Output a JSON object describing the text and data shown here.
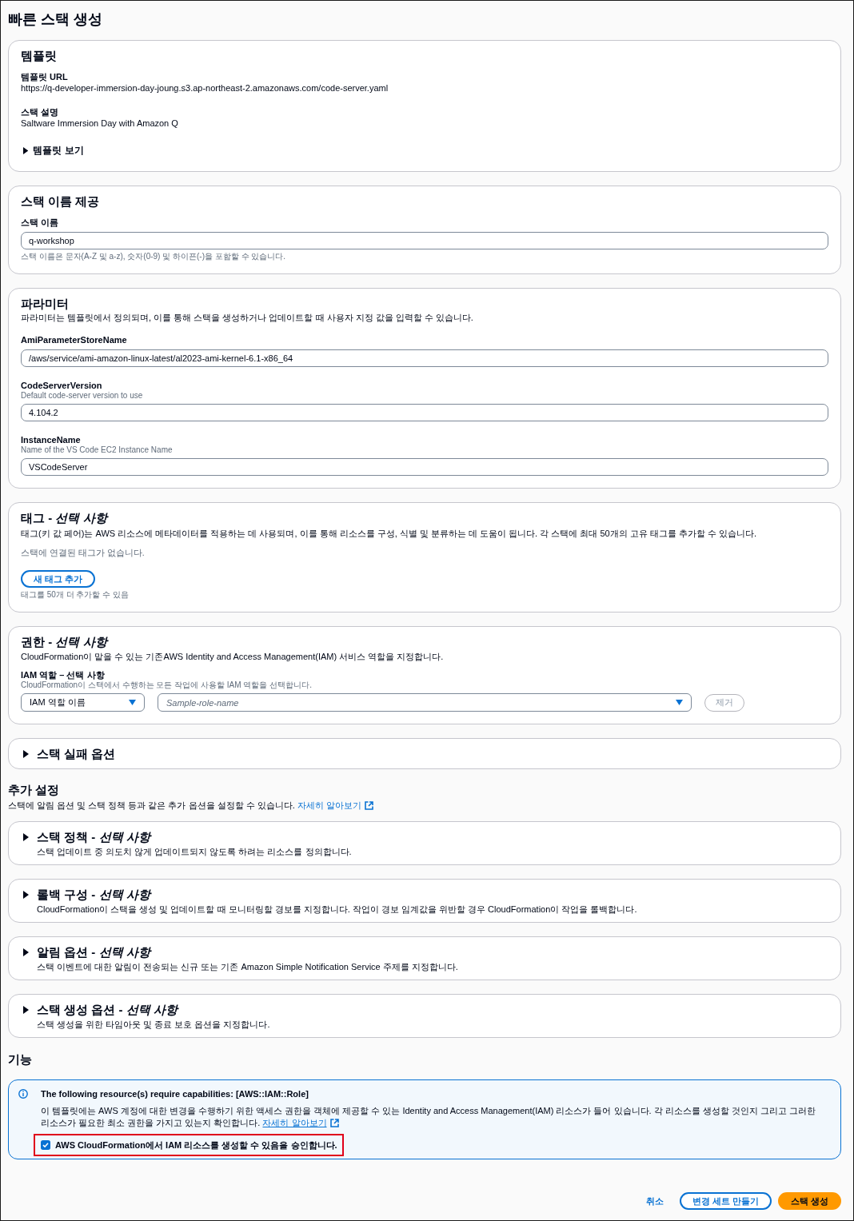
{
  "page": {
    "title": "빠른 스택 생성"
  },
  "template_card": {
    "heading": "템플릿",
    "fields": [
      {
        "label": "템플릿 URL",
        "value": "https://q-developer-immersion-day-joung.s3.ap-northeast-2.amazonaws.com/code-server.yaml"
      },
      {
        "label": "스택 설명",
        "value": "Saltware Immersion Day with Amazon Q"
      }
    ],
    "expander": {
      "label": "템플릿 보기",
      "expanded": false
    }
  },
  "stack_name_card": {
    "heading": "스택 이름 제공",
    "label": "스택 이름",
    "value": "q-workshop",
    "hint": "스택 이름은 문자(A-Z 및 a-z), 숫자(0-9) 및 하이픈(-)을 포함할 수 있습니다."
  },
  "parameters_card": {
    "heading": "파라미터",
    "description": "파라미터는 템플릿에서 정의되며, 이를 통해 스택을 생성하거나 업데이트할 때 사용자 지정 값을 입력할 수 있습니다.",
    "parameters": [
      {
        "name": "AmiParameterStoreName",
        "value": "/aws/service/ami-amazon-linux-latest/al2023-ami-kernel-6.1-x86_64"
      },
      {
        "name": "CodeServerVersion",
        "description": "Default code-server version to use",
        "value": "4.104.2"
      },
      {
        "name": "InstanceName",
        "description": "Name of the VS Code EC2 Instance Name",
        "value": "VSCodeServer"
      }
    ]
  },
  "tags_card": {
    "heading": "태그 - *선택 사항*",
    "description": "태그(키 값 페어)는 AWS 리소스에 메타데이터를 적용하는 데 사용되며, 이를 통해 리소스를 구성, 식별 및 분류하는 데 도움이 됩니다. 각 스택에 최대 50개의 고유 태그를 추가할 수 있습니다.",
    "empty_text": "스택에 연결된 태그가 없습니다.",
    "add_button": "새 태그 추가",
    "hint": "태그를 50개 더 추가할 수 있음"
  },
  "permissions_card": {
    "heading": "권한 - *선택 사항*",
    "description": "CloudFormation이 맡을 수 있는 기존AWS Identity and Access Management(IAM) 서비스 역할을 지정합니다.",
    "role_label": "IAM 역할 – 선택 사항",
    "role_description": "CloudFormation이 스택에서 수행하는 모든 작업에 사용할 IAM 역할을 선택합니다.",
    "role_type_select": {
      "value": "IAM 역할 이름"
    },
    "role_name_field": {
      "placeholder": "Sample-role-name"
    },
    "remove_button": {
      "label": "제거",
      "disabled": true
    }
  },
  "failure_options": {
    "heading": "스택 실패 옵션",
    "expanded": false
  },
  "additional_settings": {
    "heading": "추가 설정",
    "description": "스택에 알림 옵션 및 스택 정책 등과 같은 추가 옵션을 설정할 수 있습니다.",
    "link": "자세히 알아보기",
    "sections": [
      {
        "heading": "스택 정책 - *선택 사항*",
        "description": "스택 업데이트 중 의도치 않게 업데이트되지 않도록 하려는 리소스를 정의합니다.",
        "expanded": false
      },
      {
        "heading": "롤백 구성 - *선택 사항*",
        "description": "CloudFormation이 스택을 생성 및 업데이트할 때 모니터링할 경보를 지정합니다. 작업이 경보 임계값을 위반할 경우 CloudFormation이 작업을 롤백합니다.",
        "expanded": false
      },
      {
        "heading": "알림 옵션 - *선택 사항*",
        "description": "스택 이벤트에 대한 알림이 전송되는 신규 또는 기존 Amazon Simple Notification Service 주제를 지정합니다.",
        "expanded": false
      },
      {
        "heading": "스택 생성 옵션 - *선택 사항*",
        "description": "스택 생성을 위한 타임아웃 및 종료 보호 옵션을 지정합니다.",
        "expanded": false
      }
    ]
  },
  "capabilities": {
    "heading": "기능",
    "alert": {
      "title": "The following resource(s) require capabilities: [AWS::IAM::Role]",
      "body": "이 템플릿에는 AWS 계정에 대한 변경을 수행하기 위한 액세스 권한을 객체에 제공할 수 있는 Identity and Access Management(IAM) 리소스가 들어 있습니다. 각 리소스를 생성할 것인지 그리고 그러한 리소스가 필요한 최소 권한을 가지고 있는지 확인합니다.",
      "link": "자세히 알아보기",
      "acknowledgement": {
        "label": "AWS CloudFormation에서 IAM 리소스를 생성할 수 있음을 승인합니다.",
        "checked": true,
        "highlighted": true
      }
    }
  },
  "footer": {
    "buttons": [
      {
        "label": "취소",
        "kind": "link"
      },
      {
        "label": "변경 세트 만들기",
        "kind": "secondary"
      },
      {
        "label": "스택 생성",
        "kind": "primary"
      }
    ]
  }
}
